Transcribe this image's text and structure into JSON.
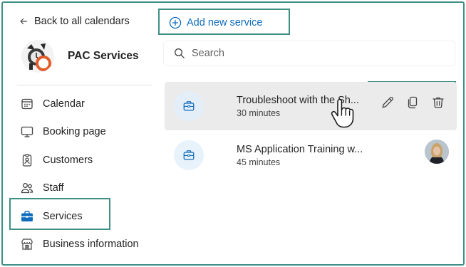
{
  "sidebar": {
    "back_label": "Back to all calendars",
    "org_name": "PAC Services",
    "items": [
      {
        "label": "Calendar",
        "icon": "calendar-icon"
      },
      {
        "label": "Booking page",
        "icon": "monitor-icon"
      },
      {
        "label": "Customers",
        "icon": "contact-card-icon"
      },
      {
        "label": "Staff",
        "icon": "people-icon"
      },
      {
        "label": "Services",
        "icon": "briefcase-icon",
        "active": true
      },
      {
        "label": "Business information",
        "icon": "building-icon"
      }
    ]
  },
  "main": {
    "add_service_label": "Add new service",
    "search_placeholder": "Search",
    "services": [
      {
        "name": "Troubleshoot with the Sh...",
        "duration": "30 minutes",
        "hovered": true
      },
      {
        "name": "MS Application Training w...",
        "duration": "45 minutes"
      }
    ],
    "actions": [
      {
        "icon": "edit-icon"
      },
      {
        "icon": "copy-icon"
      },
      {
        "icon": "delete-icon"
      }
    ]
  },
  "colors": {
    "highlight_box": "#3f8f86",
    "accent_blue": "#0f6cbd",
    "hover_row": "#ebebeb"
  }
}
